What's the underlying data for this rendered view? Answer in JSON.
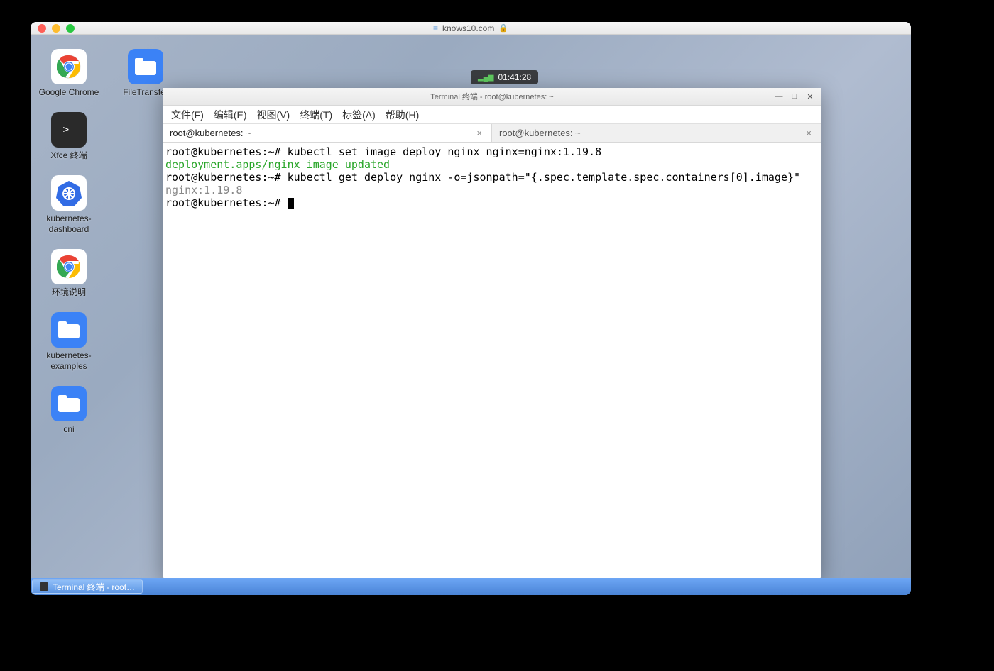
{
  "browser": {
    "url_host": "knows10.com"
  },
  "clock": {
    "time": "01:41:28"
  },
  "desktop_icons": {
    "row1": [
      {
        "label": "Google Chrome",
        "type": "chrome"
      },
      {
        "label": "FileTransfer",
        "type": "folder"
      }
    ],
    "col": [
      {
        "label": "Xfce 终端",
        "type": "terminal"
      },
      {
        "label": "kubernetes-dashboard",
        "type": "k8s"
      },
      {
        "label": "环境说明",
        "type": "chrome"
      },
      {
        "label": "kubernetes-examples",
        "type": "folder"
      },
      {
        "label": "cni",
        "type": "folder"
      }
    ]
  },
  "terminal": {
    "title": "Terminal 终端 - root@kubernetes: ~",
    "menu": [
      "文件(F)",
      "编辑(E)",
      "视图(V)",
      "终端(T)",
      "标签(A)",
      "帮助(H)"
    ],
    "tabs": [
      {
        "label": "root@kubernetes: ~",
        "active": true
      },
      {
        "label": "root@kubernetes: ~",
        "active": false
      }
    ],
    "lines": [
      {
        "prompt": "root@kubernetes:~#",
        "cmd": " kubectl set image deploy nginx nginx=nginx:1.19.8"
      },
      {
        "output_green": "deployment.apps/nginx image updated"
      },
      {
        "prompt": "root@kubernetes:~#",
        "cmd": " kubectl get deploy nginx -o=jsonpath=\"{.spec.template.spec.containers[0].image}\""
      },
      {
        "output_gray": "nginx:1.19.8"
      },
      {
        "prompt": "root@kubernetes:~#",
        "cursor": true
      }
    ]
  },
  "taskbar": {
    "item": "Terminal 终端 - root…"
  }
}
